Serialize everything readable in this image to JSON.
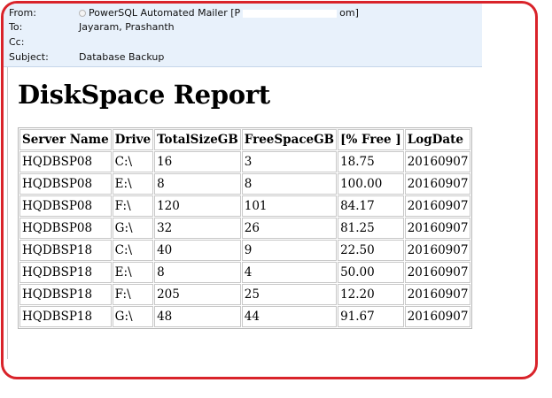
{
  "email": {
    "from_label": "From:",
    "from_value": "PowerSQL Automated Mailer [P",
    "from_value_tail": "om]",
    "to_label": "To:",
    "to_value": "Jayaram, Prashanth",
    "cc_label": "Cc:",
    "cc_value": "",
    "subject_label": "Subject:",
    "subject_value": "Database Backup"
  },
  "report": {
    "title": "DiskSpace Report",
    "columns": [
      "Server Name",
      "Drive",
      "TotalSizeGB",
      "FreeSpaceGB",
      "[% Free ]",
      "LogDate"
    ],
    "rows": [
      [
        "HQDBSP08",
        "C:\\",
        "16",
        "3",
        "18.75",
        "20160907"
      ],
      [
        "HQDBSP08",
        "E:\\",
        "8",
        "8",
        "100.00",
        "20160907"
      ],
      [
        "HQDBSP08",
        "F:\\",
        "120",
        "101",
        "84.17",
        "20160907"
      ],
      [
        "HQDBSP08",
        "G:\\",
        "32",
        "26",
        "81.25",
        "20160907"
      ],
      [
        "HQDBSP18",
        "C:\\",
        "40",
        "9",
        "22.50",
        "20160907"
      ],
      [
        "HQDBSP18",
        "E:\\",
        "8",
        "4",
        "50.00",
        "20160907"
      ],
      [
        "HQDBSP18",
        "F:\\",
        "205",
        "25",
        "12.20",
        "20160907"
      ],
      [
        "HQDBSP18",
        "G:\\",
        "48",
        "44",
        "91.67",
        "20160907"
      ]
    ]
  },
  "colors": {
    "highlight_border": "#d9232a",
    "header_background": "#e8f1fb"
  }
}
